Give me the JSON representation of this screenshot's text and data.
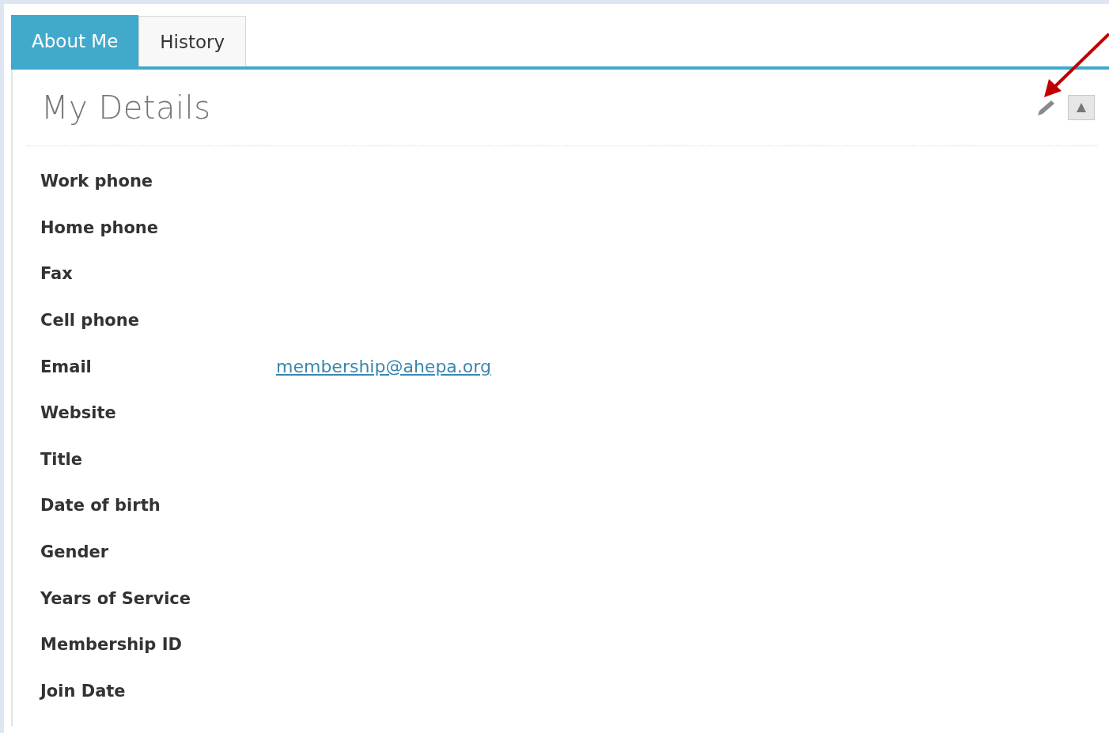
{
  "tabs": [
    {
      "label": "About Me",
      "selected": true
    },
    {
      "label": "History",
      "selected": false
    }
  ],
  "section": {
    "title": "My Details",
    "collapsed": false
  },
  "fields": [
    {
      "label": "Work phone"
    },
    {
      "label": "Home phone"
    },
    {
      "label": "Fax"
    },
    {
      "label": "Cell phone"
    },
    {
      "label": "Email",
      "value": "membership@ahepa.org"
    },
    {
      "label": "Website"
    },
    {
      "label": "Title"
    },
    {
      "label": "Date of birth"
    },
    {
      "label": "Gender"
    },
    {
      "label": "Years of Service"
    },
    {
      "label": "Membership ID"
    },
    {
      "label": "Join Date"
    }
  ]
}
